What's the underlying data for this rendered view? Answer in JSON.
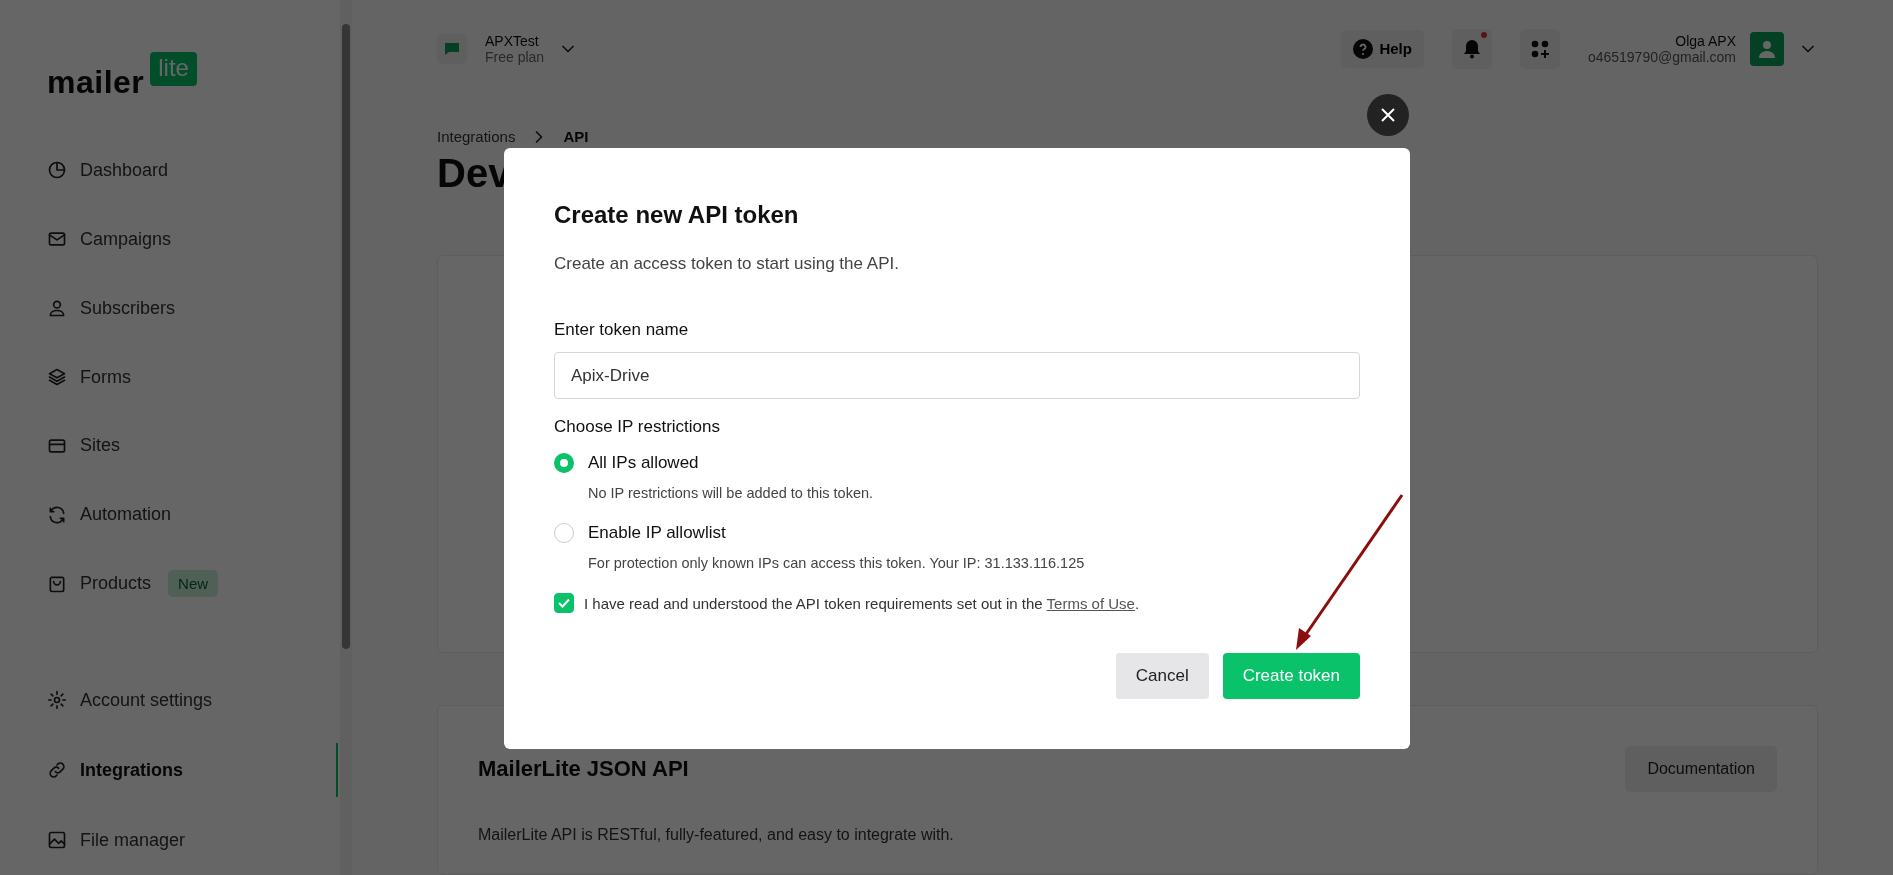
{
  "sidebar": {
    "logo": {
      "word": "mailer",
      "badge": "lite"
    },
    "items": [
      {
        "label": "Dashboard",
        "selected": false
      },
      {
        "label": "Campaigns",
        "selected": false
      },
      {
        "label": "Subscribers",
        "selected": false
      },
      {
        "label": "Forms",
        "selected": false
      },
      {
        "label": "Sites",
        "selected": false
      },
      {
        "label": "Automation",
        "selected": false
      },
      {
        "label": "Products",
        "selected": false,
        "badge": "New"
      }
    ],
    "bottom_items": [
      {
        "label": "Account settings",
        "selected": false
      },
      {
        "label": "Integrations",
        "selected": true
      },
      {
        "label": "File manager",
        "selected": false
      }
    ]
  },
  "topbar": {
    "workspace": {
      "name": "APXTest",
      "plan": "Free plan"
    },
    "help": "Help",
    "notifications": {
      "unread": true
    },
    "user": {
      "name": "Olga APX",
      "email": "o46519790@gmail.com"
    }
  },
  "breadcrumb": [
    "Integrations",
    "API"
  ],
  "page_title": "Dev",
  "api_card": {
    "title": "MailerLite JSON API",
    "button": "Documentation",
    "description": "MailerLite API is RESTful, fully-featured, and easy to integrate with."
  },
  "modal": {
    "title": "Create new API token",
    "subtitle": "Create an access token to start using the API.",
    "name_label": "Enter token name",
    "name_value": "Apix-Drive",
    "ip_label": "Choose IP restrictions",
    "ip_options": [
      {
        "label": "All IPs allowed",
        "description": "No IP restrictions will be added to this token.",
        "selected": true
      },
      {
        "label": "Enable IP allowlist",
        "description": "For protection only known IPs can access this token. Your IP: 31.133.116.125",
        "selected": false
      }
    ],
    "terms": {
      "checked": true,
      "text_before": "I have read and understood the API token requirements set out in the ",
      "link": "Terms of Use",
      "text_after": "."
    },
    "buttons": [
      {
        "label": "Cancel",
        "kind": "secondary"
      },
      {
        "label": "Create token",
        "kind": "primary"
      }
    ]
  }
}
